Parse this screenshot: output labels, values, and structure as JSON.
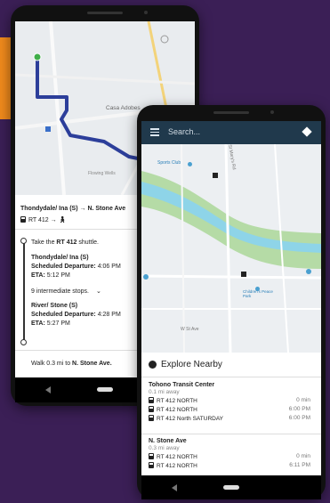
{
  "colors": {
    "background": "#3b1f56",
    "accent": "#f08a1c",
    "route": "#2c3e9a",
    "topbar": "#20394c"
  },
  "phone1": {
    "map": {
      "place_label": "Casa Adobes",
      "road_label": "Flowing Wells"
    },
    "trip": {
      "title": "Thondydale/ Ina (S) → N. Stone Ave",
      "route_label": "RT 412 →",
      "step1": {
        "prefix": "Take the ",
        "route": "RT 412",
        "suffix": " shuttle."
      },
      "stop1": {
        "name": "Thondydale/ Ina (S)",
        "departure_label": "Scheduled Departure:",
        "departure_time": "4:06 PM",
        "eta_label": "ETA:",
        "eta_time": "5:12 PM"
      },
      "intermediate": "9 intermediate stops.",
      "stop2": {
        "name": "River/ Stone (S)",
        "departure_label": "Scheduled Departure:",
        "departure_time": "4:28 PM",
        "eta_label": "ETA:",
        "eta_time": "5:27 PM"
      },
      "walk": {
        "prefix": "Walk 0.3 mi to ",
        "dest": "N. Stone Ave."
      }
    }
  },
  "phone2": {
    "search": {
      "placeholder": "Search..."
    },
    "map": {
      "label_sports": "Sports Club",
      "label_park": "Children's Peace Park",
      "label_north": "St Mary's Rd",
      "label_street": "W St Ave"
    },
    "panel": {
      "title": "Explore Nearby",
      "stations": [
        {
          "name": "Tohono Transit Center",
          "distance": "0.1 mi away",
          "routes": [
            {
              "label": "RT 412 NORTH",
              "time": "0 min"
            },
            {
              "label": "RT 412 NORTH",
              "time": "6:00 PM"
            },
            {
              "label": "RT 412 North SATURDAY",
              "time": "6:00 PM"
            }
          ]
        },
        {
          "name": "N. Stone Ave",
          "distance": "0.3 mi away",
          "routes": [
            {
              "label": "RT 412 NORTH",
              "time": "0 min"
            },
            {
              "label": "RT 412 NORTH",
              "time": "6:11 PM"
            }
          ]
        }
      ]
    }
  }
}
